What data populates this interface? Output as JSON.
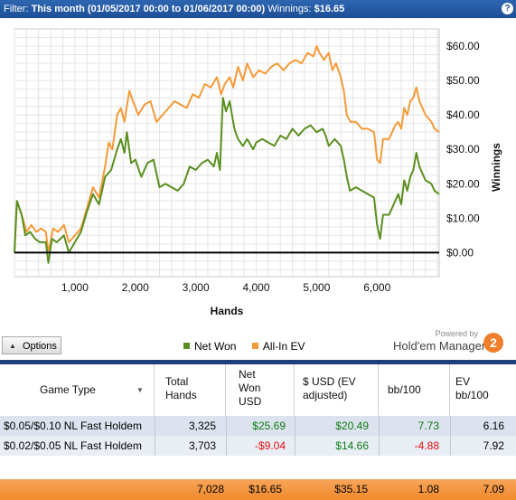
{
  "header": {
    "filter_label": "Filter:",
    "filter_value": "This month (01/05/2017 00:00 to 01/06/2017 00:00)",
    "winnings_label": "Winnings:",
    "winnings_value": "$16.65",
    "help_label": "?"
  },
  "chart_data": {
    "type": "line",
    "xlabel": "Hands",
    "ylabel": "Winnings",
    "xlim": [
      0,
      7028
    ],
    "ylim": [
      -7,
      65
    ],
    "x_ticks": [
      "1,000",
      "2,000",
      "3,000",
      "4,000",
      "5,000",
      "6,000"
    ],
    "y_ticks": [
      "$60.00",
      "$50.00",
      "$40.00",
      "$30.00",
      "$20.00",
      "$10.00",
      "$0.00"
    ],
    "grid": true,
    "series": [
      {
        "name": "Net Won",
        "color": "#5a8f1f",
        "points": [
          [
            0,
            0
          ],
          [
            40,
            15
          ],
          [
            120,
            11
          ],
          [
            180,
            5
          ],
          [
            260,
            6
          ],
          [
            340,
            4
          ],
          [
            420,
            3
          ],
          [
            520,
            3
          ],
          [
            560,
            -3
          ],
          [
            620,
            4
          ],
          [
            700,
            3
          ],
          [
            820,
            5
          ],
          [
            900,
            0
          ],
          [
            1000,
            3
          ],
          [
            1100,
            6
          ],
          [
            1200,
            12
          ],
          [
            1300,
            17
          ],
          [
            1400,
            14
          ],
          [
            1500,
            22
          ],
          [
            1600,
            24
          ],
          [
            1700,
            30
          ],
          [
            1760,
            33
          ],
          [
            1820,
            29
          ],
          [
            1860,
            35
          ],
          [
            1930,
            26
          ],
          [
            2000,
            27
          ],
          [
            2100,
            22
          ],
          [
            2200,
            26
          ],
          [
            2300,
            27
          ],
          [
            2400,
            19
          ],
          [
            2500,
            20
          ],
          [
            2600,
            19
          ],
          [
            2700,
            18
          ],
          [
            2800,
            20
          ],
          [
            2900,
            25
          ],
          [
            3000,
            24
          ],
          [
            3100,
            26
          ],
          [
            3200,
            27
          ],
          [
            3300,
            25
          ],
          [
            3350,
            29
          ],
          [
            3400,
            24
          ],
          [
            3450,
            45
          ],
          [
            3500,
            41
          ],
          [
            3560,
            44
          ],
          [
            3640,
            36
          ],
          [
            3700,
            33
          ],
          [
            3780,
            31
          ],
          [
            3850,
            33
          ],
          [
            3950,
            30
          ],
          [
            4000,
            32
          ],
          [
            4100,
            33
          ],
          [
            4200,
            32
          ],
          [
            4300,
            31
          ],
          [
            4400,
            34
          ],
          [
            4500,
            33
          ],
          [
            4600,
            36
          ],
          [
            4700,
            34
          ],
          [
            4800,
            36
          ],
          [
            4900,
            37
          ],
          [
            5000,
            35
          ],
          [
            5100,
            36
          ],
          [
            5150,
            34
          ],
          [
            5200,
            31
          ],
          [
            5300,
            33
          ],
          [
            5400,
            31
          ],
          [
            5450,
            27
          ],
          [
            5500,
            22
          ],
          [
            5550,
            18
          ],
          [
            5650,
            19
          ],
          [
            5750,
            18
          ],
          [
            5850,
            17
          ],
          [
            5950,
            16
          ],
          [
            6000,
            8
          ],
          [
            6050,
            4
          ],
          [
            6100,
            11
          ],
          [
            6200,
            11
          ],
          [
            6300,
            15
          ],
          [
            6350,
            17
          ],
          [
            6400,
            14
          ],
          [
            6450,
            21
          ],
          [
            6500,
            18
          ],
          [
            6550,
            22
          ],
          [
            6600,
            24
          ],
          [
            6650,
            29
          ],
          [
            6700,
            25
          ],
          [
            6800,
            21
          ],
          [
            6900,
            20
          ],
          [
            6950,
            18
          ],
          [
            7028,
            17
          ]
        ]
      },
      {
        "name": "All-In EV",
        "color": "#f59a39",
        "points": [
          [
            0,
            0
          ],
          [
            40,
            15
          ],
          [
            120,
            11
          ],
          [
            200,
            6
          ],
          [
            280,
            8
          ],
          [
            360,
            6
          ],
          [
            440,
            7
          ],
          [
            520,
            6
          ],
          [
            560,
            0
          ],
          [
            640,
            7
          ],
          [
            720,
            6
          ],
          [
            820,
            8
          ],
          [
            900,
            3
          ],
          [
            1000,
            5
          ],
          [
            1100,
            7
          ],
          [
            1200,
            13
          ],
          [
            1300,
            19
          ],
          [
            1400,
            16
          ],
          [
            1500,
            25
          ],
          [
            1560,
            32
          ],
          [
            1620,
            30
          ],
          [
            1700,
            40
          ],
          [
            1760,
            42
          ],
          [
            1820,
            38
          ],
          [
            1900,
            47
          ],
          [
            1960,
            44
          ],
          [
            2050,
            40
          ],
          [
            2150,
            43
          ],
          [
            2250,
            44
          ],
          [
            2350,
            38
          ],
          [
            2450,
            40
          ],
          [
            2550,
            42
          ],
          [
            2650,
            44
          ],
          [
            2750,
            43
          ],
          [
            2850,
            42
          ],
          [
            2950,
            46
          ],
          [
            3050,
            45
          ],
          [
            3150,
            49
          ],
          [
            3250,
            48
          ],
          [
            3350,
            51
          ],
          [
            3420,
            46
          ],
          [
            3480,
            49
          ],
          [
            3560,
            51
          ],
          [
            3620,
            48
          ],
          [
            3700,
            54
          ],
          [
            3780,
            50
          ],
          [
            3850,
            55
          ],
          [
            3950,
            51
          ],
          [
            4050,
            53
          ],
          [
            4150,
            52
          ],
          [
            4250,
            54
          ],
          [
            4350,
            55
          ],
          [
            4450,
            53
          ],
          [
            4550,
            55
          ],
          [
            4650,
            56
          ],
          [
            4750,
            55
          ],
          [
            4850,
            58
          ],
          [
            4950,
            57
          ],
          [
            5000,
            60
          ],
          [
            5050,
            58
          ],
          [
            5120,
            56
          ],
          [
            5200,
            58
          ],
          [
            5260,
            53
          ],
          [
            5320,
            55
          ],
          [
            5400,
            51
          ],
          [
            5450,
            47
          ],
          [
            5500,
            40
          ],
          [
            5560,
            38
          ],
          [
            5650,
            38
          ],
          [
            5750,
            36
          ],
          [
            5850,
            36
          ],
          [
            5950,
            35
          ],
          [
            6000,
            27
          ],
          [
            6050,
            26
          ],
          [
            6100,
            33
          ],
          [
            6200,
            33
          ],
          [
            6300,
            37
          ],
          [
            6350,
            38
          ],
          [
            6400,
            36
          ],
          [
            6450,
            42
          ],
          [
            6500,
            40
          ],
          [
            6550,
            44
          ],
          [
            6600,
            45
          ],
          [
            6650,
            48
          ],
          [
            6700,
            44
          ],
          [
            6800,
            40
          ],
          [
            6900,
            38
          ],
          [
            6950,
            36
          ],
          [
            7028,
            35
          ]
        ]
      }
    ],
    "zero_line": 0
  },
  "options_bar": {
    "options_label": "Options",
    "legend": [
      {
        "name": "Net Won",
        "color": "#5a8f1f"
      },
      {
        "name": "All-In EV",
        "color": "#f59a39"
      }
    ],
    "powered_by": "Powered by",
    "brand_name": "Hold'em Manager",
    "brand_logo": "2"
  },
  "table": {
    "headers": [
      "Game Type",
      "Total\nHands",
      "Net\nWon\nUSD",
      "$ USD (EV\nadjusted)",
      "bb/100",
      "EV\nbb/100"
    ],
    "rows": [
      {
        "game": "$0.05/$0.10 NL Fast Holdem",
        "hands": "3,325",
        "net": "$25.69",
        "ev": "$20.49",
        "bb": "7.73",
        "evbb": "6.16",
        "net_sign": "pos",
        "bb_sign": "pos"
      },
      {
        "game": "$0.02/$0.05 NL Fast Holdem",
        "hands": "3,703",
        "net": "-$9.04",
        "ev": "$14.66",
        "bb": "-4.88",
        "evbb": "7.92",
        "net_sign": "neg",
        "bb_sign": "neg"
      }
    ],
    "totals": {
      "hands": "7,028",
      "net": "$16.65",
      "ev": "$35.15",
      "bb": "1.08",
      "evbb": "7.09"
    }
  }
}
